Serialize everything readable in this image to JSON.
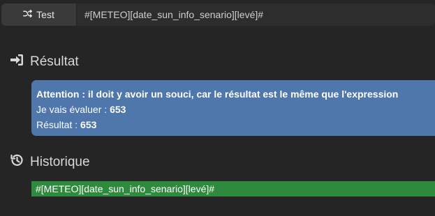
{
  "toolbar": {
    "test_button_label": "Test",
    "test_icon": "shuffle-icon",
    "expression_value": "#[METEO][date_sun_info_senario][levé]#"
  },
  "result": {
    "title": "Résultat",
    "icon": "sign-in-icon",
    "alert_color": "#4f77ab",
    "warning": "Attention : il doit y avoir un souci, car le résultat est le même que l'expression",
    "evaluate_label": "Je vais évaluer : ",
    "evaluate_value": "653",
    "result_label": "Résultat : ",
    "result_value": "653"
  },
  "history": {
    "title": "Historique",
    "icon": "history-icon",
    "item_color": "#2e8b3e",
    "items": [
      "#[METEO][date_sun_info_senario][levé]#"
    ]
  }
}
